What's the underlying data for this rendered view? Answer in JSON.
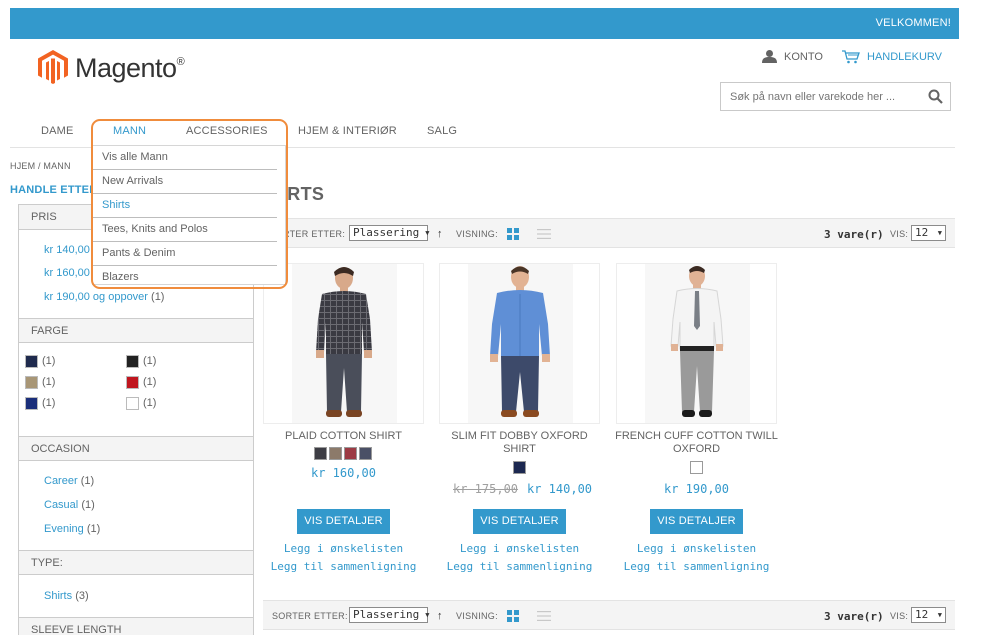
{
  "header": {
    "welcome": "VELKOMMEN!",
    "logo_text": "Magento",
    "logo_reg": "®",
    "account": "KONTO",
    "cart": "HANDLEKURV",
    "search_placeholder": "Søk på navn eller varekode her ..."
  },
  "nav": {
    "items": [
      "DAME",
      "MANN",
      "ACCESSORIES",
      "HJEM & INTERIØR",
      "SALG"
    ],
    "active": "MANN"
  },
  "dropdown": {
    "items": [
      "Vis alle Mann",
      "New Arrivals",
      "Shirts",
      "Tees, Knits and Polos",
      "Pants & Denim",
      "Blazers"
    ],
    "selected": "Shirts"
  },
  "breadcrumb": "HJEM / MANN",
  "sidebar": {
    "title": "HANDLE ETTER",
    "price": {
      "heading": "PRIS",
      "items": [
        {
          "label": "kr 140,00",
          "count": ""
        },
        {
          "label": "kr 160,00",
          "count": ""
        },
        {
          "label": "kr 190,00 og oppover",
          "count": "(1)"
        }
      ]
    },
    "color": {
      "heading": "FARGE",
      "swatches": [
        {
          "color": "#1f2a4d",
          "count": "(1)"
        },
        {
          "color": "#222222",
          "count": "(1)"
        },
        {
          "color": "#a89676",
          "count": "(1)"
        },
        {
          "color": "#c0161f",
          "count": "(1)"
        },
        {
          "color": "#1a2e7a",
          "count": "(1)"
        },
        {
          "color": "#ffffff",
          "count": "(1)"
        }
      ]
    },
    "occasion": {
      "heading": "OCCASION",
      "items": [
        {
          "label": "Career",
          "count": "(1)"
        },
        {
          "label": "Casual",
          "count": "(1)"
        },
        {
          "label": "Evening",
          "count": "(1)"
        }
      ]
    },
    "type": {
      "heading": "TYPE:",
      "items": [
        {
          "label": "Shirts",
          "count": "(3)"
        }
      ]
    },
    "sleeve": {
      "heading": "SLEEVE LENGTH"
    }
  },
  "main": {
    "title": "IRTS",
    "toolbar": {
      "sort_label_top": "RTER ETTER:",
      "sort_label_bottom": "SORTER ETTER:",
      "sort_value": "Plassering",
      "view_label": "VISNING:",
      "count": "3 vare(r)",
      "show_label": "VIS:",
      "show_value": "12"
    }
  },
  "products": [
    {
      "name": "PLAID COTTON SHIRT",
      "price": "kr 160,00",
      "old_price": "",
      "swatches": [
        "#3d3d44",
        "#8c7a6a",
        "#9c3b44",
        "#4a5066"
      ],
      "button": "VIS DETALJER",
      "wishlist": "Legg i ønskelisten",
      "compare": "Legg til sammenligning"
    },
    {
      "name": "SLIM FIT DOBBY OXFORD SHIRT",
      "price": "kr 140,00",
      "old_price": "kr 175,00",
      "swatches": [
        "#1c2850"
      ],
      "button": "VIS DETALJER",
      "wishlist": "Legg i ønskelisten",
      "compare": "Legg til sammenligning"
    },
    {
      "name": "FRENCH CUFF COTTON TWILL OXFORD",
      "price": "kr 190,00",
      "old_price": "",
      "swatches": [
        "#ffffff"
      ],
      "button": "VIS DETALJER",
      "wishlist": "Legg i ønskelisten",
      "compare": "Legg til sammenligning"
    }
  ],
  "colors": {
    "accent": "#3399cc",
    "highlight": "#f08c3c"
  }
}
